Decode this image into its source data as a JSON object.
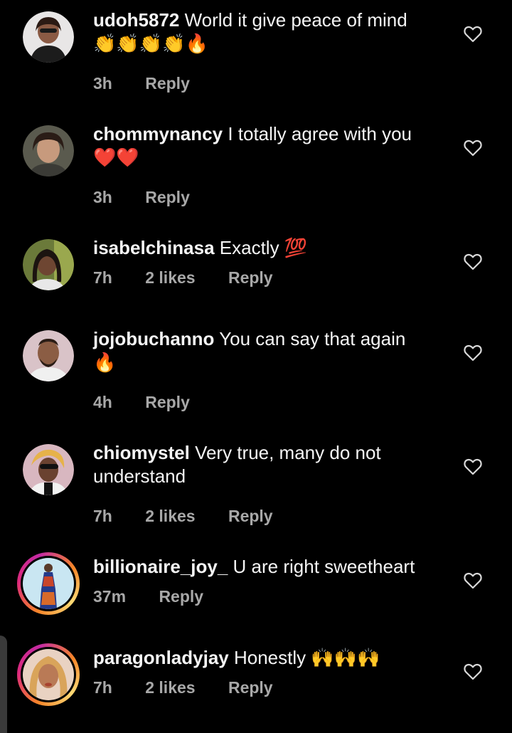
{
  "colors": {
    "background": "#000000",
    "text": "#f5f5f5",
    "meta": "#a8a8a8",
    "heart": "#d8d8d8",
    "story_ring": [
      "#f58529",
      "#dd2a7b",
      "#feda75"
    ]
  },
  "comments": [
    {
      "username": "udoh5872",
      "text": "World it give peace of mind",
      "emojis": "👏👏👏👏🔥",
      "time": "3h",
      "likes": "",
      "reply": "Reply"
    },
    {
      "username": "chommynancy",
      "text": "I totally agree with you",
      "emojis": "❤️❤️",
      "time": "3h",
      "likes": "",
      "reply": "Reply"
    },
    {
      "username": "isabelchinasa",
      "text": "Exactly 💯",
      "emojis": "",
      "time": "7h",
      "likes": "2 likes",
      "reply": "Reply"
    },
    {
      "username": "jojobuchanno",
      "text": "You can say that again",
      "emojis": "🔥",
      "time": "4h",
      "likes": "",
      "reply": "Reply"
    },
    {
      "username": "chiomystel",
      "text": "Very true, many do not",
      "text_line2": "understand",
      "time": "7h",
      "likes": "2 likes",
      "reply": "Reply"
    },
    {
      "username": "billionaire_joy_",
      "text": "U are right sweetheart",
      "time": "37m",
      "likes": "",
      "reply": "Reply"
    },
    {
      "username": "paragonladyjay",
      "text": "Honestly 🙌🙌🙌",
      "time": "7h",
      "likes": "2 likes",
      "reply": "Reply"
    }
  ]
}
